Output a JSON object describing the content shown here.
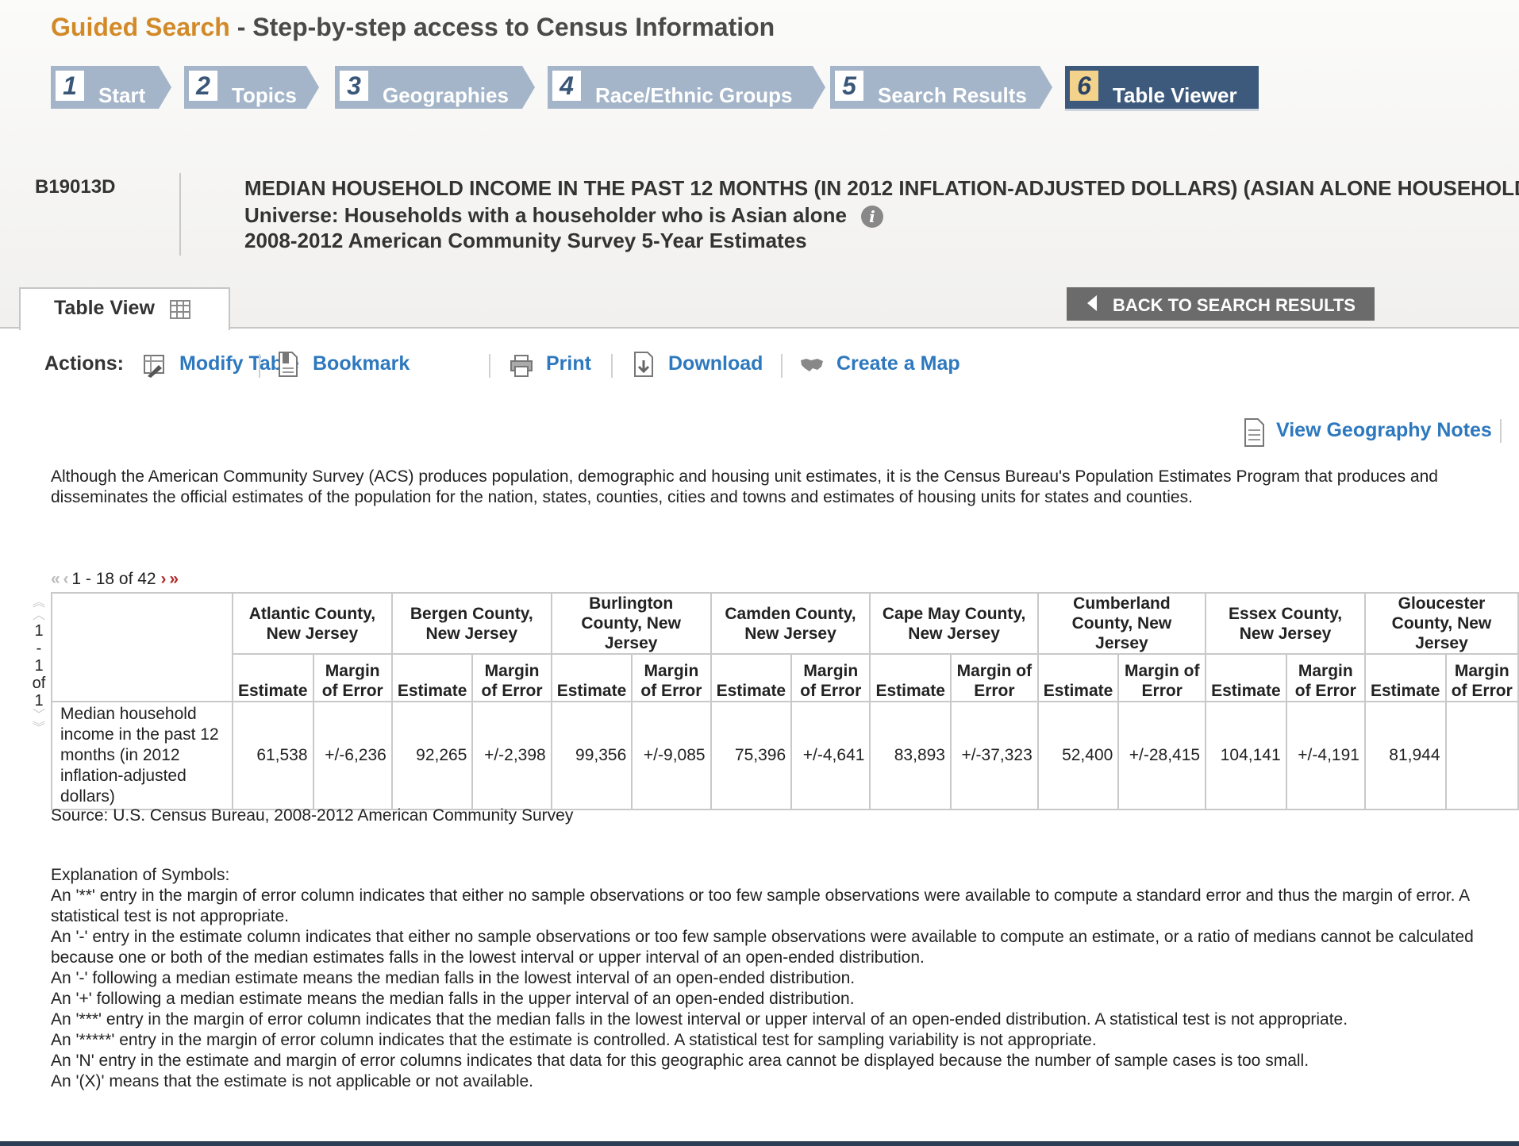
{
  "header": {
    "title_accent": "Guided Search",
    "title_rest": " - Step-by-step access to Census Information"
  },
  "steps": [
    {
      "num": "1",
      "label": "Start"
    },
    {
      "num": "2",
      "label": "Topics"
    },
    {
      "num": "3",
      "label": "Geographies"
    },
    {
      "num": "4",
      "label": "Race/Ethnic Groups"
    },
    {
      "num": "5",
      "label": "Search Results"
    },
    {
      "num": "6",
      "label": "Table Viewer"
    }
  ],
  "table_info": {
    "id": "B19013D",
    "title": "MEDIAN HOUSEHOLD INCOME IN THE PAST 12 MONTHS (IN 2012 INFLATION-ADJUSTED DOLLARS) (ASIAN ALONE HOUSEHOLDER)",
    "universe": "Universe: Households with a householder who is Asian alone",
    "survey": "2008-2012 American Community Survey 5-Year Estimates"
  },
  "tabs": {
    "table_view": "Table View",
    "back_button": "BACK TO SEARCH RESULTS"
  },
  "actions": {
    "label": "Actions:",
    "modify": "Modify Table",
    "bookmark": "Bookmark",
    "print": "Print",
    "download": "Download",
    "map": "Create a Map",
    "geo_notes": "View Geography Notes"
  },
  "disclaimer": "Although the American Community Survey (ACS) produces population, demographic and housing unit estimates, it is the Census Bureau's Population Estimates Program that produces and disseminates the official estimates of the population for the nation, states, counties, cities and towns and estimates of housing units for states and counties.",
  "pager": {
    "range": "1 - 18 of 42",
    "row_top": "1",
    "row_dash": "-",
    "row_mid": "1",
    "row_of": "of",
    "row_total": "1"
  },
  "table": {
    "subheaders": {
      "estimate": "Estimate",
      "moe": "Margin of Error"
    },
    "row_label": "Median household income in the past 12 months (in 2012 inflation-adjusted dollars)",
    "columns": [
      {
        "geo": "Atlantic County, New Jersey",
        "estimate": "61,538",
        "moe": "+/-6,236"
      },
      {
        "geo": "Bergen County, New Jersey",
        "estimate": "92,265",
        "moe": "+/-2,398"
      },
      {
        "geo": "Burlington County, New Jersey",
        "estimate": "99,356",
        "moe": "+/-9,085"
      },
      {
        "geo": "Camden County, New Jersey",
        "estimate": "75,396",
        "moe": "+/-4,641"
      },
      {
        "geo": "Cape May County, New Jersey",
        "estimate": "83,893",
        "moe": "+/-37,323"
      },
      {
        "geo": "Cumberland County, New Jersey",
        "estimate": "52,400",
        "moe": "+/-28,415"
      },
      {
        "geo": "Essex County, New Jersey",
        "estimate": "104,141",
        "moe": "+/-4,191"
      },
      {
        "geo": "Gloucester County, New Jersey",
        "estimate": "81,944",
        "moe": ""
      }
    ]
  },
  "source": "Source: U.S. Census Bureau, 2008-2012 American Community Survey",
  "symbols": {
    "heading": "Explanation of Symbols:",
    "lines": [
      "An '**' entry in the margin of error column indicates that either no sample observations or too few sample observations were available to compute a standard error and thus the margin of error. A statistical test is not appropriate.",
      "An '-' entry in the estimate column indicates that either no sample observations or too few sample observations were available to compute an estimate, or a ratio of medians cannot be calculated because one or both of the median estimates falls in the lowest interval or upper interval of an open-ended distribution.",
      "An '-' following a median estimate means the median falls in the lowest interval of an open-ended distribution.",
      "An '+' following a median estimate means the median falls in the upper interval of an open-ended distribution.",
      "An '***' entry in the margin of error column indicates that the median falls in the lowest interval or upper interval of an open-ended distribution. A statistical test is not appropriate.",
      "An '*****' entry in the margin of error column indicates that the estimate is controlled. A statistical test for sampling variability is not appropriate.",
      "An 'N' entry in the estimate and margin of error columns indicates that data for this geographic area cannot be displayed because the number of sample cases is too small.",
      "An '(X)' means that the estimate is not applicable or not available."
    ]
  }
}
